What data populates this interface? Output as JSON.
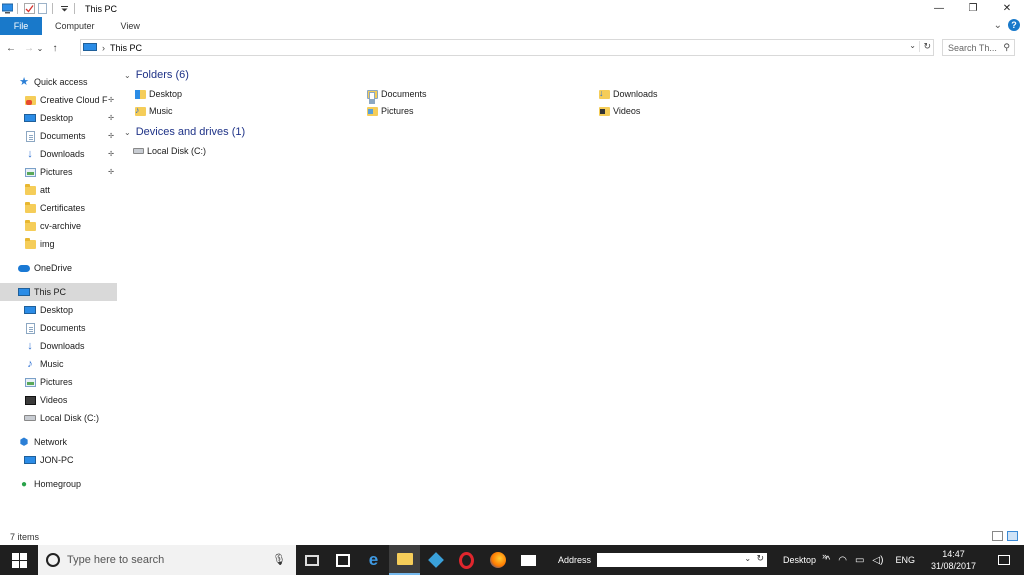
{
  "window": {
    "title": "This PC",
    "controls": {
      "minimize": "—",
      "maximize": "❐",
      "close": "✕"
    }
  },
  "ribbon": {
    "tabs": [
      "File",
      "Computer",
      "View"
    ],
    "expand_glyph": "⌄",
    "help_glyph": "?"
  },
  "navbar": {
    "back": "←",
    "forward": "→",
    "recent": "⌄",
    "up": "↑",
    "path_sep": "›",
    "path": "This PC",
    "dropdown": "⌄",
    "refresh": "↻",
    "search_placeholder": "Search Th...",
    "search_glyph": "⚲"
  },
  "sidebar": {
    "quick_access": "Quick access",
    "quick_items": [
      {
        "label": "Creative Cloud F",
        "icon": "creative-cloud-folder-icon",
        "pinned": true
      },
      {
        "label": "Desktop",
        "icon": "desktop-icon",
        "pinned": true
      },
      {
        "label": "Documents",
        "icon": "documents-icon",
        "pinned": true
      },
      {
        "label": "Downloads",
        "icon": "downloads-icon",
        "pinned": true
      },
      {
        "label": "Pictures",
        "icon": "pictures-icon",
        "pinned": true
      },
      {
        "label": "att",
        "icon": "folder-icon",
        "pinned": false
      },
      {
        "label": "Certificates",
        "icon": "folder-icon",
        "pinned": false
      },
      {
        "label": "cv-archive",
        "icon": "folder-icon",
        "pinned": false
      },
      {
        "label": "img",
        "icon": "folder-icon",
        "pinned": false
      }
    ],
    "pin_glyph": "📌",
    "onedrive": "OneDrive",
    "this_pc": "This PC",
    "pc_items": [
      {
        "label": "Desktop",
        "icon": "desktop-icon"
      },
      {
        "label": "Documents",
        "icon": "documents-icon"
      },
      {
        "label": "Downloads",
        "icon": "downloads-icon"
      },
      {
        "label": "Music",
        "icon": "music-icon"
      },
      {
        "label": "Pictures",
        "icon": "pictures-icon"
      },
      {
        "label": "Videos",
        "icon": "videos-icon"
      },
      {
        "label": "Local Disk (C:)",
        "icon": "local-disk-icon"
      }
    ],
    "network": "Network",
    "network_items": [
      {
        "label": "JON-PC",
        "icon": "computer-icon"
      }
    ],
    "homegroup": "Homegroup"
  },
  "content": {
    "folders_header": "Folders (6)",
    "folders": [
      {
        "label": "Desktop",
        "icon": "desktop-folder-icon"
      },
      {
        "label": "Documents",
        "icon": "documents-folder-icon"
      },
      {
        "label": "Downloads",
        "icon": "downloads-folder-icon"
      },
      {
        "label": "Music",
        "icon": "music-folder-icon"
      },
      {
        "label": "Pictures",
        "icon": "pictures-folder-icon"
      },
      {
        "label": "Videos",
        "icon": "videos-folder-icon"
      }
    ],
    "drives_header": "Devices and drives (1)",
    "drives": [
      {
        "label": "Local Disk (C:)",
        "icon": "local-disk-icon"
      }
    ],
    "caret": "⌄"
  },
  "statusbar": {
    "count": "7 items"
  },
  "taskbar": {
    "search_placeholder": "Type here to search",
    "mic_glyph": "🎤",
    "address_label": "Address",
    "address_value": "",
    "address_dropdown": "⌄",
    "address_refresh": "↻",
    "desktop_label": "Desktop",
    "more_glyph": "»",
    "tray_up": "^",
    "language": "ENG",
    "time": "14:47",
    "date": "31/08/2017"
  },
  "colors": {
    "accent": "#1979ca",
    "group_header": "#1e3287",
    "folder": "#f5cd59",
    "taskbar": "#1f1f1f",
    "selection": "#d9d9d9"
  }
}
